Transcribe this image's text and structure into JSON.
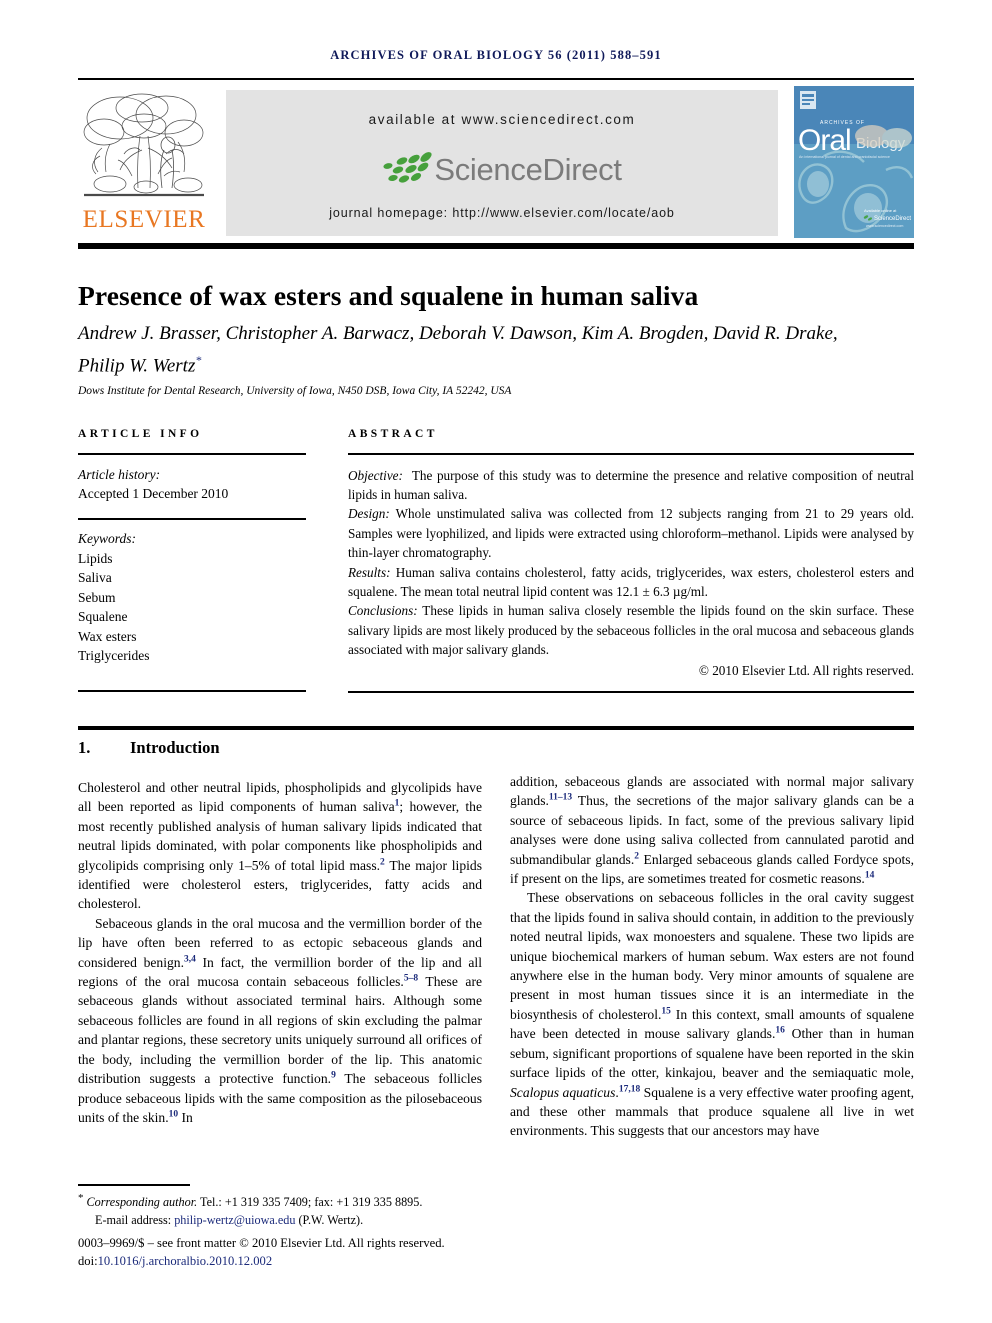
{
  "running_head": "ARCHIVES OF ORAL BIOLOGY 56 (2011) 588–591",
  "banner": {
    "elsevier_wordmark": "ELSEVIER",
    "available_at": "available at www.sciencedirect.com",
    "sciencedirect_word": "ScienceDirect",
    "journal_homepage": "journal homepage: http://www.elsevier.com/locate/aob",
    "cover": {
      "line1": "ARCHIVES OF",
      "line2": "Oral",
      "line3": "Biology",
      "tagline": "An international journal of dental and craniofacial science",
      "footer_brand": "ScienceDirect",
      "footer_url": "www.sciencedirect.com"
    },
    "colors": {
      "elsevier_orange": "#e87722",
      "band_gray": "#e3e3e3",
      "sciencedirect_gray": "#7b7b7b",
      "leaf_green": "#46a03c",
      "cover_blue": "#4a86b8"
    }
  },
  "article": {
    "title": "Presence of wax esters and squalene in human saliva",
    "authors": "Andrew J. Brasser, Christopher A. Barwacz, Deborah V. Dawson, Kim A. Brogden, David R. Drake, Philip W. Wertz",
    "corresponding_marker": "*",
    "affiliation": "Dows Institute for Dental Research, University of Iowa, N450 DSB, Iowa City, IA 52242, USA"
  },
  "article_info": {
    "heading": "ARTICLE INFO",
    "history_label": "Article history:",
    "history_value": "Accepted 1 December 2010",
    "keywords_label": "Keywords:",
    "keywords": [
      "Lipids",
      "Saliva",
      "Sebum",
      "Squalene",
      "Wax esters",
      "Triglycerides"
    ]
  },
  "abstract": {
    "heading": "ABSTRACT",
    "objective_label": "Objective:",
    "objective_text": "The purpose of this study was to determine the presence and relative composition of neutral lipids in human saliva.",
    "design_label": "Design:",
    "design_text": "Whole unstimulated saliva was collected from 12 subjects ranging from 21 to 29 years old. Samples were lyophilized, and lipids were extracted using chloroform–methanol. Lipids were analysed by thin-layer chromatography.",
    "results_label": "Results:",
    "results_text": "Human saliva contains cholesterol, fatty acids, triglycerides, wax esters, cholesterol esters and squalene. The mean total neutral lipid content was 12.1 ± 6.3 µg/ml.",
    "conclusions_label": "Conclusions:",
    "conclusions_text": "These lipids in human saliva closely resemble the lipids found on the skin surface. These salivary lipids are most likely produced by the sebaceous follicles in the oral mucosa and sebaceous glands associated with major salivary glands.",
    "copyright": "© 2010 Elsevier Ltd. All rights reserved."
  },
  "section": {
    "number": "1.",
    "heading": "Introduction"
  },
  "body": {
    "left_p1_a": "Cholesterol and other neutral lipids, phospholipids and glycolipids have all been reported as lipid components of human saliva",
    "left_p1_ref1": "1",
    "left_p1_b": "; however, the most recently published analysis of human salivary lipids indicated that neutral lipids dominated, with polar components like phospholipids and glycolipids comprising only 1–5% of total lipid mass.",
    "left_p1_ref2": "2",
    "left_p1_c": " The major lipids identified were cholesterol esters, triglycerides, fatty acids and cholesterol.",
    "left_p2_a": "Sebaceous glands in the oral mucosa and the vermillion border of the lip have often been referred to as ectopic sebaceous glands and considered benign.",
    "left_p2_ref1": "3,4",
    "left_p2_b": " In fact, the vermillion border of the lip and all regions of the oral mucosa contain sebaceous follicles.",
    "left_p2_ref2": "5–8",
    "left_p2_c": " These are sebaceous glands without associated terminal hairs. Although some sebaceous follicles are found in all regions of skin excluding the palmar and plantar regions, these secretory units uniquely surround all orifices of the body, including the vermillion border of the lip. This anatomic distribution suggests a protective function.",
    "left_p2_ref3": "9",
    "left_p2_d": " The sebaceous follicles produce sebaceous lipids with the same composition as the pilosebaceous units of the skin.",
    "left_p2_ref4": "10",
    "left_p2_e": " In",
    "right_p1_a": "addition, sebaceous glands are associated with normal major salivary glands.",
    "right_p1_ref1": "11–13",
    "right_p1_b": " Thus, the secretions of the major salivary glands can be a source of sebaceous lipids. In fact, some of the previous salivary lipid analyses were done using saliva collected from cannulated parotid and submandibular glands.",
    "right_p1_ref2": "2",
    "right_p1_c": " Enlarged sebaceous glands called Fordyce spots, if present on the lips, are sometimes treated for cosmetic reasons.",
    "right_p1_ref3": "14",
    "right_p2_a": "These observations on sebaceous follicles in the oral cavity suggest that the lipids found in saliva should contain, in addition to the previously noted neutral lipids, wax monoesters and squalene. These two lipids are unique biochemical markers of human sebum. Wax esters are not found anywhere else in the human body. Very minor amounts of squalene are present in most human tissues since it is an intermediate in the biosynthesis of cholesterol.",
    "right_p2_ref1": "15",
    "right_p2_b": " In this context, small amounts of squalene have been detected in mouse salivary glands.",
    "right_p2_ref2": "16",
    "right_p2_c": " Other than in human sebum, significant proportions of squalene have been reported in the skin surface lipids of the otter, kinkajou, beaver and the semiaquatic mole, ",
    "right_p2_italic": "Scalopus aquaticus",
    "right_p2_d": ".",
    "right_p2_ref3": "17,18",
    "right_p2_e": " Squalene is a very effective water proofing agent, and these other mammals that produce squalene all live in wet environments. This suggests that our ancestors may have"
  },
  "footer": {
    "corresponding_star": "*",
    "corresponding_label": "Corresponding author.",
    "corresponding_contact": " Tel.: +1 319 335 7409; fax: +1 319 335 8895.",
    "email_label": "E-mail address:",
    "email": "philip-wertz@uiowa.edu",
    "email_owner": "(P.W. Wertz).",
    "issn_line": "0003–9969/$ – see front matter © 2010 Elsevier Ltd. All rights reserved.",
    "doi_label": "doi:",
    "doi": "10.1016/j.archoralbio.2010.12.002"
  }
}
